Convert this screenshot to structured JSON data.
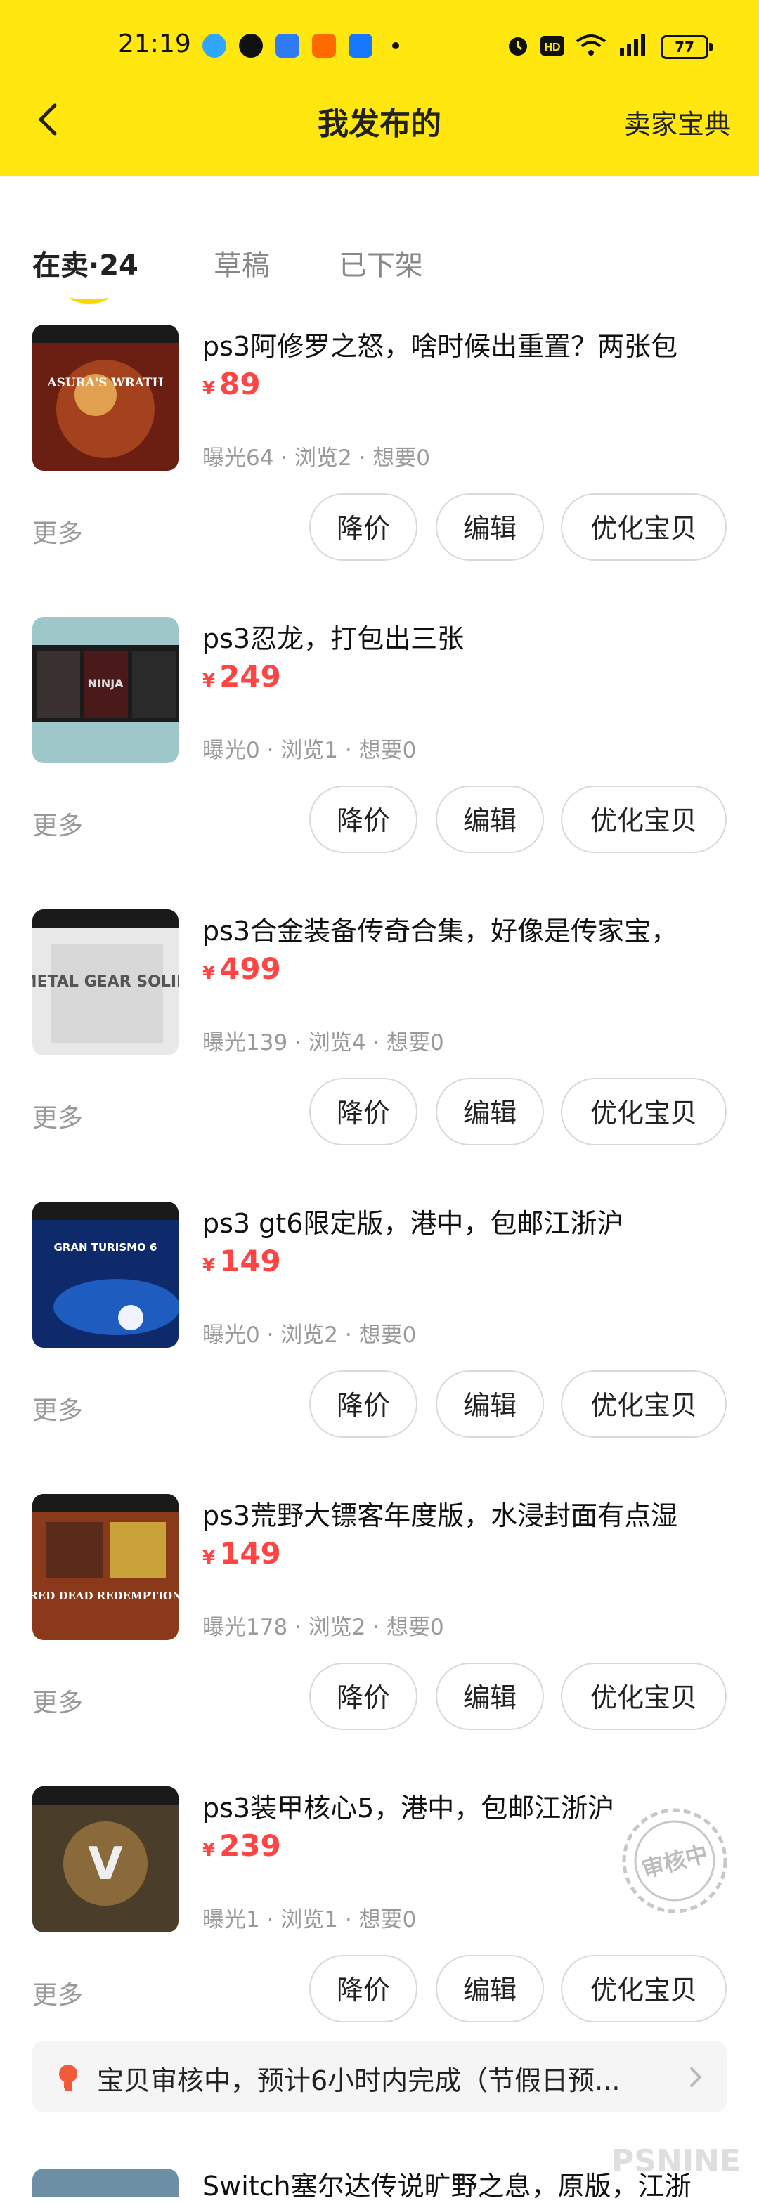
{
  "status_bar": {
    "time": "21:19",
    "battery": "77"
  },
  "header": {
    "back_icon": "chevron-left-icon",
    "title": "我发布的",
    "right_link": "卖家宝典"
  },
  "tabs": [
    {
      "label": "在卖·24",
      "active": true
    },
    {
      "label": "草稿",
      "active": false
    },
    {
      "label": "已下架",
      "active": false
    }
  ],
  "currency": "¥",
  "item_actions": {
    "more": "更多",
    "reduce": "降价",
    "edit": "编辑",
    "optimize": "优化宝贝"
  },
  "items": [
    {
      "title": "ps3阿修罗之怒，啥时候出重置？两张包",
      "price": "89",
      "stats": "曝光64 · 浏览2 · 想要0",
      "thumb_label": "ASURA'S WRATH"
    },
    {
      "title": "ps3忍龙，打包出三张",
      "price": "249",
      "stats": "曝光0 · 浏览1 · 想要0",
      "thumb_label": "NINJA"
    },
    {
      "title": "ps3合金装备传奇合集，好像是传家宝，",
      "price": "499",
      "stats": "曝光139 · 浏览4 · 想要0",
      "thumb_label": "METAL GEAR SOLID"
    },
    {
      "title": "ps3 gt6限定版，港中，包邮江浙沪",
      "price": "149",
      "stats": "曝光0 · 浏览2 · 想要0",
      "thumb_label": "GRAN TURISMO 6"
    },
    {
      "title": "ps3荒野大镖客年度版，水浸封面有点湿",
      "price": "149",
      "stats": "曝光178 · 浏览2 · 想要0",
      "thumb_label": "RED DEAD REDEMPTION"
    },
    {
      "title": "ps3装甲核心5，港中，包邮江浙沪",
      "price": "239",
      "stats": "曝光1 · 浏览1 · 想要0",
      "thumb_label": "V"
    }
  ],
  "audit_banner": {
    "text": "宝贝审核中，预计6小时内完成（节假日预...",
    "stamp": "审核中"
  },
  "next_item": {
    "title": "Switch塞尔达传说旷野之息，原版，江浙"
  },
  "watermark": "PSNINE",
  "colors": {
    "brand_yellow": "#FFE70F",
    "price_red": "#FF4444"
  }
}
